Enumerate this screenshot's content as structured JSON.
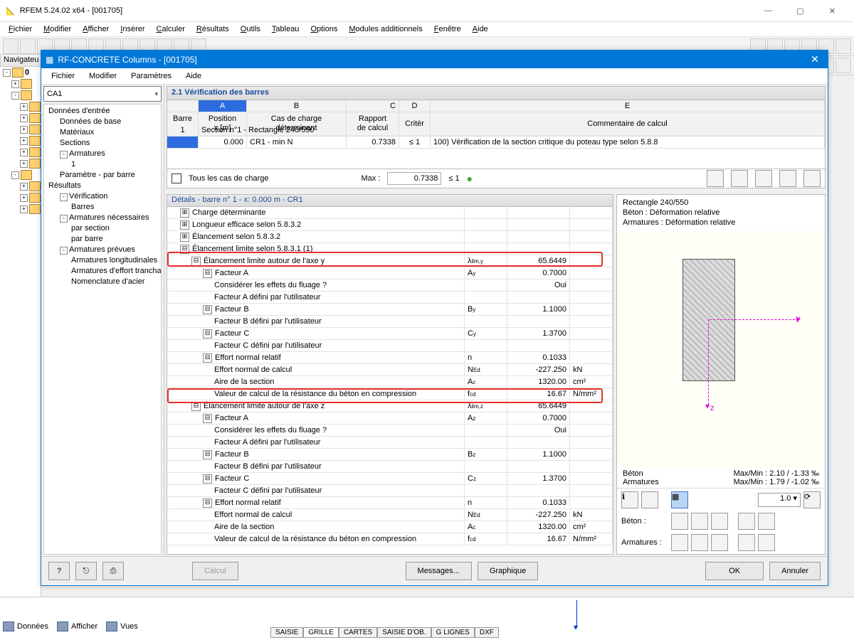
{
  "app": {
    "title": "RFEM 5.24.02 x64 - [001705]"
  },
  "main_menu": [
    "Fichier",
    "Modifier",
    "Afficher",
    "Insérer",
    "Calculer",
    "Résultats",
    "Outils",
    "Tableau",
    "Options",
    "Modules additionnels",
    "Fenêtre",
    "Aide"
  ],
  "nav_label": "Navigateu",
  "modal": {
    "title": "RF-CONCRETE Columns - [001705]",
    "menu": [
      "Fichier",
      "Modifier",
      "Paramètres",
      "Aide"
    ],
    "combo": "CA1",
    "tree": [
      {
        "t": "Données d'entrée",
        "lvl": 0
      },
      {
        "t": "Données de base",
        "lvl": 1
      },
      {
        "t": "Matériaux",
        "lvl": 1
      },
      {
        "t": "Sections",
        "lvl": 1
      },
      {
        "t": "Armatures",
        "lvl": 1,
        "exp": "-"
      },
      {
        "t": "1",
        "lvl": 2
      },
      {
        "t": "Paramètre - par barre",
        "lvl": 1
      },
      {
        "t": "Résultats",
        "lvl": 0
      },
      {
        "t": "Vérification",
        "lvl": 1,
        "exp": "-"
      },
      {
        "t": "Barres",
        "lvl": 2
      },
      {
        "t": "Armatures nécessaires",
        "lvl": 1,
        "exp": "-"
      },
      {
        "t": "par section",
        "lvl": 2
      },
      {
        "t": "par barre",
        "lvl": 2
      },
      {
        "t": "Armatures prévues",
        "lvl": 1,
        "exp": "-"
      },
      {
        "t": "Armatures longitudinales",
        "lvl": 2
      },
      {
        "t": "Armatures d'effort trancha",
        "lvl": 2
      },
      {
        "t": "Nomenclature d'acier",
        "lvl": 2
      }
    ],
    "section_title": "2.1 Vérification des barres",
    "cols": {
      "barre": "Barre n°",
      "A": "A",
      "B": "B",
      "C": "C",
      "D": "D",
      "E": "E",
      "pos": "Position",
      "pos2": "x [m]",
      "cas": "Cas de charge",
      "cas2": "déterminant",
      "rap": "Rapport",
      "rap2": "de calcul",
      "crit": "Critèr",
      "comm": "Commentaire de calcul"
    },
    "rows": {
      "section": "Section n°1 - Rectangle 240/550",
      "r1": {
        "n": "1",
        "x": "0.000",
        "cas": "CR1 - min N",
        "rapport": "0.7338",
        "crit": "≤ 1",
        "comm": "100) Vérification de la section critique du poteau type selon 5.8.8"
      }
    },
    "check_label": "Tous les cas de charge",
    "max_label": "Max :",
    "max_val": "0.7338",
    "max_crit": "≤ 1",
    "details_title": "Détails  -  barre n° 1  -  x: 0.000 m  -  CR1",
    "details": [
      {
        "tg": "+",
        "lab": "Charge déterminante",
        "lvl": 0
      },
      {
        "tg": "+",
        "lab": "Longueur efficace selon 5.8.3.2",
        "lvl": 0
      },
      {
        "tg": "+",
        "lab": "Élancement selon 5.8.3.2",
        "lvl": 0
      },
      {
        "tg": "-",
        "lab": "Élancement limite selon 5.8.3.1 (1)",
        "lvl": 0
      },
      {
        "tg": "-",
        "lab": "Élancement limite autour de l'axe  y",
        "sym": "λ lim,y",
        "val": "65.6449",
        "lvl": 1,
        "hot": 1
      },
      {
        "tg": "-",
        "lab": "Facteur A",
        "sym": "A y",
        "val": "0.7000",
        "lvl": 2
      },
      {
        "lab": "Considérer les effets du fluage ?",
        "val": "Oui",
        "lvl": 3
      },
      {
        "lab": "Facteur A défini par l'utilisateur",
        "lvl": 3
      },
      {
        "tg": "-",
        "lab": "Facteur B",
        "sym": "B y",
        "val": "1.1000",
        "lvl": 2
      },
      {
        "lab": "Facteur B défini par l'utilisateur",
        "lvl": 3
      },
      {
        "tg": "-",
        "lab": "Facteur C",
        "sym": "C y",
        "val": "1.3700",
        "lvl": 2
      },
      {
        "lab": "Facteur C défini par l'utilisateur",
        "lvl": 3
      },
      {
        "tg": "-",
        "lab": "Effort normal relatif",
        "sym": "n",
        "val": "0.1033",
        "lvl": 2
      },
      {
        "lab": "Effort normal de calcul",
        "sym": "N Ed",
        "val": "-227.250",
        "unit": "kN",
        "lvl": 3
      },
      {
        "lab": "Aire de la section",
        "sym": "A c",
        "val": "1320.00",
        "unit": "cm²",
        "lvl": 3
      },
      {
        "lab": "Valeur de calcul de la résistance du béton en compression",
        "sym": "f cd",
        "val": "16.67",
        "unit": "N/mm²",
        "lvl": 3
      },
      {
        "tg": "-",
        "lab": "Élancement limite autour de l'axe  z",
        "sym": "λ lim,z",
        "val": "65.6449",
        "lvl": 1,
        "hot": 2
      },
      {
        "tg": "-",
        "lab": "Facteur A",
        "sym": "A z",
        "val": "0.7000",
        "lvl": 2
      },
      {
        "lab": "Considérer les effets du fluage ?",
        "val": "Oui",
        "lvl": 3
      },
      {
        "lab": "Facteur A défini par l'utilisateur",
        "lvl": 3
      },
      {
        "tg": "-",
        "lab": "Facteur B",
        "sym": "B z",
        "val": "1.1000",
        "lvl": 2
      },
      {
        "lab": "Facteur B défini par l'utilisateur",
        "lvl": 3
      },
      {
        "tg": "-",
        "lab": "Facteur C",
        "sym": "C z",
        "val": "1.3700",
        "lvl": 2
      },
      {
        "lab": "Facteur C défini par l'utilisateur",
        "lvl": 3
      },
      {
        "tg": "-",
        "lab": "Effort normal relatif",
        "sym": "n",
        "val": "0.1033",
        "lvl": 2
      },
      {
        "lab": "Effort normal de calcul",
        "sym": "N Ed",
        "val": "-227.250",
        "unit": "kN",
        "lvl": 3
      },
      {
        "lab": "Aire de la section",
        "sym": "A c",
        "val": "1320.00",
        "unit": "cm²",
        "lvl": 3
      },
      {
        "lab": "Valeur de calcul de la résistance du béton en compression",
        "sym": "f cd",
        "val": "16.67",
        "unit": "N/mm²",
        "lvl": 3
      }
    ],
    "preview": {
      "section": "Rectangle 240/550",
      "beton_line": "Béton : Déformation relative",
      "arm_line": "Armatures : Déformation relative",
      "y": "y",
      "z": "z",
      "beton_lab": "Béton",
      "arm_lab": "Armatures",
      "beton_stat": "Max/Min : 2.10 / -1.33 ‰",
      "arm_stat": "Max/Min : 1.79 / -1.02 ‰",
      "beton_row": "Béton :",
      "arm_row": "Armatures :",
      "spin": "1.0"
    },
    "footer": {
      "calcul": "Calcul",
      "messages": "Messages...",
      "graphique": "Graphique",
      "ok": "OK",
      "annuler": "Annuler"
    }
  },
  "app_tabs1": [
    "Données",
    "Afficher",
    "Vues"
  ],
  "app_tabs2": [
    "SAISIE",
    "GRILLE",
    "CARTES",
    "SAISIE D'OB.",
    "G LIGNES",
    "DXF"
  ]
}
